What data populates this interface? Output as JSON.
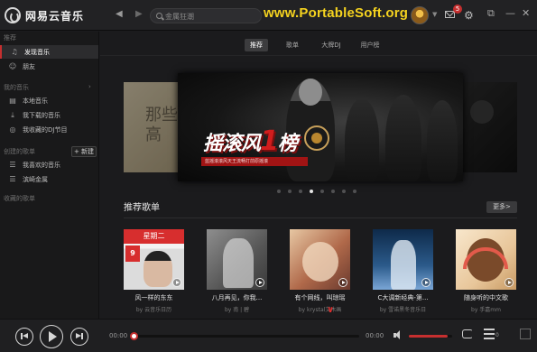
{
  "app": {
    "title": "网易云音乐"
  },
  "search": {
    "placeholder": "金属狂潮"
  },
  "watermark": "www.PortableSoft.org",
  "user": {
    "mail_badge": "5"
  },
  "sidebar": {
    "headings": {
      "recommend": "推荐",
      "my_music": "我的音乐",
      "created_playlists": "创建的歌单",
      "collected_playlists": "收藏的歌单"
    },
    "recommend_items": [
      {
        "label": "发现音乐",
        "icon": "music-note-icon",
        "active": true
      },
      {
        "label": "朋友",
        "icon": "friends-icon",
        "active": false
      }
    ],
    "my_music_items": [
      {
        "label": "本地音乐",
        "icon": "local-music-icon"
      },
      {
        "label": "我下载的音乐",
        "icon": "download-icon"
      },
      {
        "label": "我收藏的DJ节目",
        "icon": "radio-icon"
      }
    ],
    "new_playlist_label": "+ 新建",
    "created_items": [
      {
        "label": "我喜欢的音乐",
        "icon": "playlist-icon"
      },
      {
        "label": "滨崎金属",
        "icon": "playlist-icon"
      }
    ]
  },
  "tabs": [
    {
      "label": "推荐",
      "active": true
    },
    {
      "label": "歌单",
      "active": false
    },
    {
      "label": "大牌DJ",
      "active": false
    },
    {
      "label": "用户榜",
      "active": false
    }
  ],
  "banner": {
    "title_a": "摇滚风",
    "title_num": "1",
    "title_b": "榜",
    "strip_text": "蓝摇滚滚风天王流畅打前原摇滚",
    "left_text": "那些天高",
    "dots": 8,
    "active_dot": 4
  },
  "section": {
    "title": "推荐歌单",
    "more_label": "更多>"
  },
  "playlists": [
    {
      "title": "风一样的东东",
      "author": "by 云音乐日历",
      "tag": "星期二",
      "date": "9"
    },
    {
      "title": "八月再见，你我...",
      "author": "by 南 | 碧"
    },
    {
      "title": "有个网线，叫琼瑶",
      "author": "by krystal艾木画"
    },
    {
      "title": "C大调新经典-第...",
      "author": "by 雪诺黑冬音乐日"
    },
    {
      "title": "随身听的中文歌",
      "author": "by 手嘉mm"
    }
  ],
  "player": {
    "elapsed": "00:00",
    "total": "00:00",
    "progress": 0.0,
    "volume": 0.9
  },
  "colors": {
    "accent": "#c62f2f",
    "watermark": "#f5d31f",
    "background": "#1b1b1d"
  }
}
